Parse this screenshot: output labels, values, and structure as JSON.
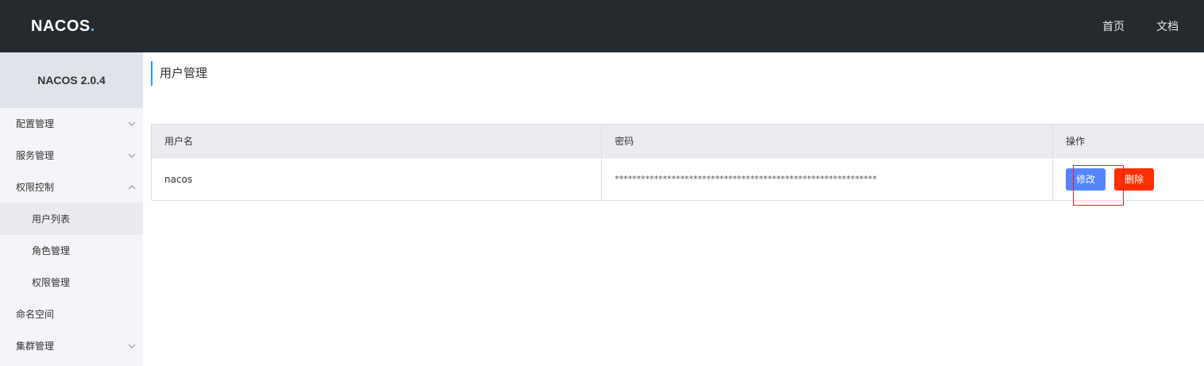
{
  "header": {
    "logo_text": "NACOS",
    "logo_dot": ".",
    "nav": [
      "首页",
      "文档"
    ]
  },
  "sidebar": {
    "title": "NACOS 2.0.4",
    "items": [
      {
        "label": "配置管理",
        "chevron": "down"
      },
      {
        "label": "服务管理",
        "chevron": "down"
      },
      {
        "label": "权限控制",
        "chevron": "up"
      },
      {
        "label": "用户列表",
        "sub": true,
        "active": true
      },
      {
        "label": "角色管理",
        "sub": true
      },
      {
        "label": "权限管理",
        "sub": true
      },
      {
        "label": "命名空间"
      },
      {
        "label": "集群管理",
        "chevron": "down"
      }
    ]
  },
  "main": {
    "title": "用户管理",
    "table": {
      "columns": [
        "用户名",
        "密码",
        "操作"
      ],
      "rows": [
        {
          "username": "nacos",
          "password": "************************************************************",
          "edit_label": "修改",
          "delete_label": "删除"
        }
      ]
    }
  },
  "colors": {
    "topbar": "#252a2f",
    "accent": "#209bfa",
    "edit_button": "#5584ff",
    "delete_button": "#ff3000",
    "highlight": "#e8202a"
  }
}
